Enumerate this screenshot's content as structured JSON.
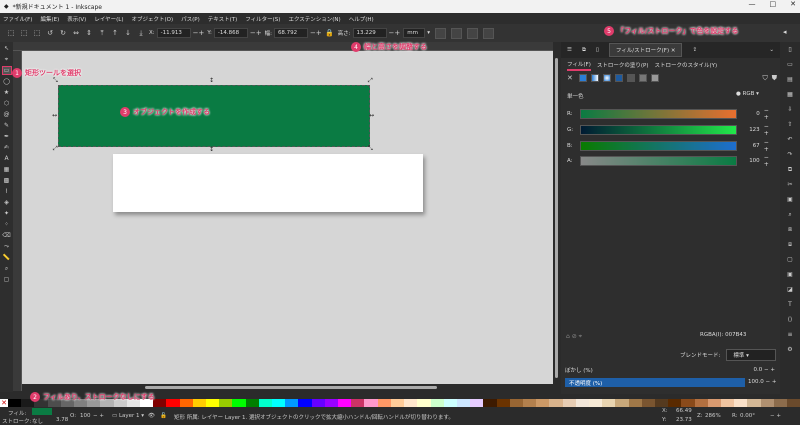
{
  "window": {
    "title": "*新規ドキュメント 1 - Inkscape",
    "controls": [
      "—",
      "□",
      "✕"
    ]
  },
  "menubar": [
    "ファイル(F)",
    "編集(E)",
    "表示(V)",
    "レイヤー(L)",
    "オブジェクト(O)",
    "パス(P)",
    "テキスト(T)",
    "フィルター(S)",
    "エクステンション(N)",
    "ヘルプ(H)"
  ],
  "toolctrl": {
    "x_label": "X:",
    "x_value": "-11.913",
    "y_label": "Y:",
    "y_value": "-14.868",
    "w_label": "幅:",
    "w_value": "68.792",
    "h_label": "高さ:",
    "h_value": "13.229",
    "unit": "mm"
  },
  "annotations": {
    "a1": {
      "num": "1",
      "text": "矩形ツールを選択"
    },
    "a2": {
      "num": "2",
      "text": "フィルあり、ストロークなしにする"
    },
    "a3": {
      "num": "3",
      "text": "オブジェクトを作成する"
    },
    "a4": {
      "num": "4",
      "text": "幅と高さを調整する"
    },
    "a5": {
      "num": "5",
      "text": "「フィル/ストローク」で色を設定する"
    }
  },
  "panel": {
    "tab_title": "フィル/ストローク(F)",
    "tab_close": "✕",
    "subtabs": [
      "フィル(F)",
      "ストロークの塗り(P)",
      "ストロークのスタイル(Y)"
    ],
    "flat_label": "単一色",
    "mode": "RGB",
    "sliders": [
      {
        "label": "R:",
        "value": "0",
        "color_from": "#0a7b43",
        "color_to": "#e86f2f"
      },
      {
        "label": "G:",
        "value": "123",
        "color_from": "#001a33",
        "color_to": "#22e84a"
      },
      {
        "label": "B:",
        "value": "67",
        "color_from": "#0a7b00",
        "color_to": "#1e6ecf"
      },
      {
        "label": "A:",
        "value": "100",
        "color_from": "#888888",
        "color_to": "#0a7b43"
      }
    ],
    "rgba_label": "RGBA(I):",
    "rgba_value": "007B43",
    "blend_label": "ブレンドモード:",
    "blend_value": "標準",
    "blur_label": "ぼかし (%)",
    "blur_value": "0.0",
    "opacity_label": "不透明度 (%)",
    "opacity_value": "100.0",
    "opacity_fraction": 1.0
  },
  "statusbar": {
    "fill_label": "フィル:",
    "stroke_label": "ストローク:",
    "stroke_value": "なし",
    "stroke_width": "3.78",
    "o_label": "O:",
    "o_value": "100",
    "layer": "Layer 1",
    "message": "矩形 所属: レイヤー Layer 1. 選択オブジェクトのクリックで拡大縮小ハンドル/回転ハンドルが切り替わります。",
    "x_label": "X:",
    "x_value": "66.49",
    "y_label": "Y:",
    "y_value": "23.73",
    "z_label": "Z:",
    "z_value": "286%",
    "r_label": "R:",
    "r_value": "0.00°"
  },
  "palette_colors": [
    "#000000",
    "#1a1a1a",
    "#333333",
    "#4d4d4d",
    "#666666",
    "#808080",
    "#999999",
    "#b3b3b3",
    "#cccccc",
    "#e6e6e6",
    "#ffffff",
    "#800000",
    "#ff0000",
    "#ff6600",
    "#ffcc00",
    "#ffff00",
    "#99cc00",
    "#00ff00",
    "#008000",
    "#00ffcc",
    "#00ffff",
    "#0099ff",
    "#0000ff",
    "#6600ff",
    "#9900ff",
    "#ff00ff",
    "#cc3366",
    "#ff99cc",
    "#ff9966",
    "#ffcc99",
    "#ffe6cc",
    "#ffffcc",
    "#ccffcc",
    "#ccffff",
    "#cce6ff",
    "#e6ccff",
    "#3d1a00",
    "#6b3300",
    "#996633",
    "#b3804d",
    "#cc9966",
    "#d9b38c",
    "#e6ccb3",
    "#f2e6d9",
    "#f7ead6",
    "#e8d4b0",
    "#c8a87a",
    "#a07848",
    "#7a5530",
    "#553a1f",
    "#5a2a00",
    "#8a4a1a",
    "#b37040",
    "#d99a70",
    "#f0c4a0",
    "#fae0c8",
    "#d4b896",
    "#b09070",
    "#8c6c4c",
    "#6a4a2c"
  ],
  "fill_swatch": "#0a7b43"
}
